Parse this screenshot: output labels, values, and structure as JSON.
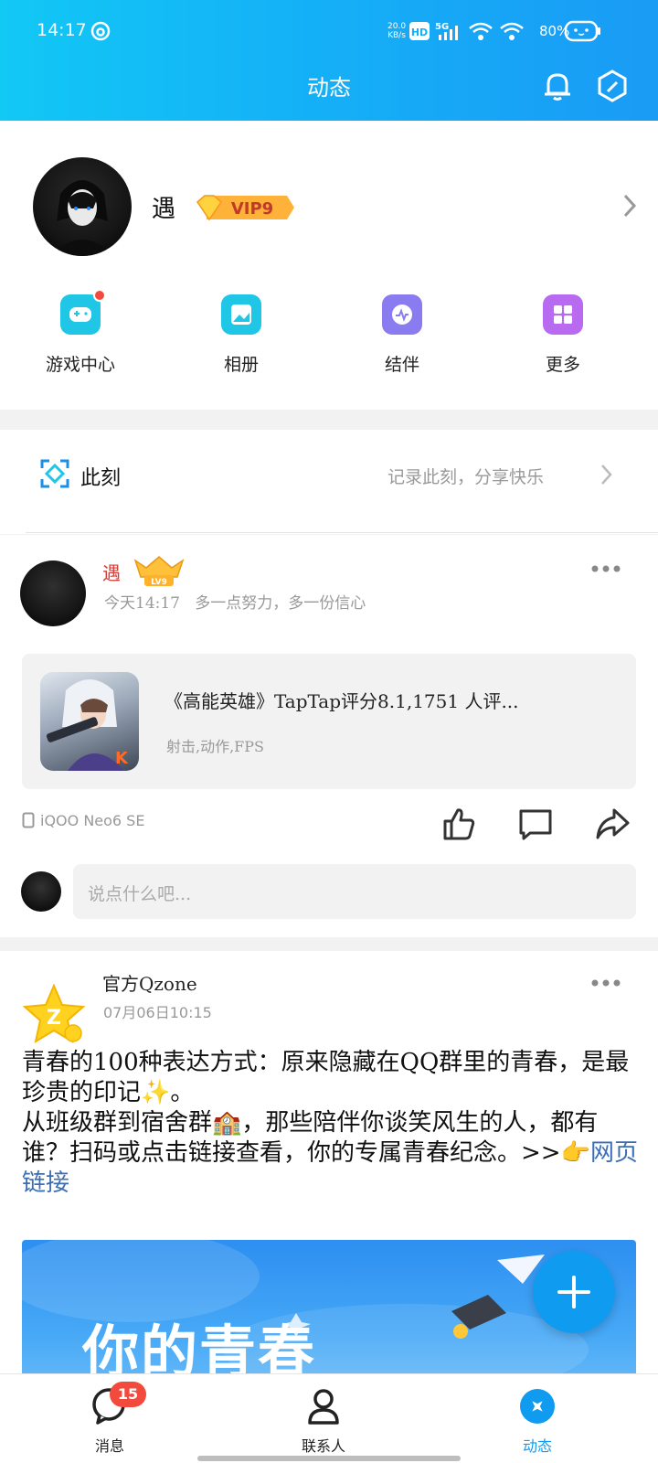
{
  "status_bar": {
    "time": "14:17",
    "net_speed_value": "20.0",
    "net_speed_unit": "KB/s",
    "hd": "HD",
    "five_g": "5G",
    "battery": "80%"
  },
  "header": {
    "title": "动态",
    "bell_icon": "bell-icon",
    "settings_icon": "hexagon-settings-icon"
  },
  "profile": {
    "username": "遇",
    "vip_label": "VIP9",
    "quick_actions": [
      {
        "label": "游戏中心",
        "icon": "gamepad-icon",
        "color": "#1fc6e6",
        "has_dot": true
      },
      {
        "label": "相册",
        "icon": "photo-album-icon",
        "color": "#1fc6e6"
      },
      {
        "label": "结伴",
        "icon": "companion-chat-icon",
        "color": "#8a7cf0"
      },
      {
        "label": "更多",
        "icon": "grid-more-icon",
        "color": "#b86bf0"
      }
    ]
  },
  "moment": {
    "label": "此刻",
    "hint": "记录此刻，分享快乐"
  },
  "post1": {
    "author": "遇",
    "level": "LV9",
    "time": "今天14:17",
    "caption": "多一点努力，多一份信心",
    "share_title": "《高能英雄》TapTap评分8.1,1751 人评...",
    "share_tags": "射击,动作,FPS",
    "device": "iQOO Neo6 SE",
    "comment_placeholder": "说点什么吧..."
  },
  "post2": {
    "author": "官方Qzone",
    "time": "07月06日10:15",
    "body_line1": "青春的100种表达方式：原来隐藏在QQ群里的青春，是最珍贵的印记✨。",
    "body_line2": "从班级群到宿舍群🏫，那些陪伴你谈笑风生的人，都有谁？扫码或点击链接查看，你的专属青春纪念。>>👉",
    "link_text": "网页链接",
    "banner_text": "你的青春"
  },
  "bottom_nav": {
    "messages_label": "消息",
    "messages_badge": "15",
    "contacts_label": "联系人",
    "feed_label": "动态"
  },
  "colors": {
    "header_start": "#12c8f5",
    "header_end": "#1a9bf5",
    "accent": "#0f9bf0",
    "badge": "#f24b3d"
  }
}
